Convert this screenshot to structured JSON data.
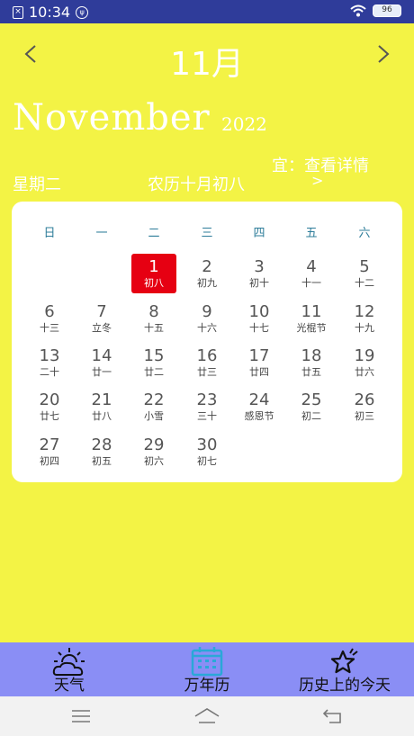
{
  "status_bar": {
    "time": "10:34",
    "battery": "96"
  },
  "header": {
    "month_title": "11月",
    "english_month": "November",
    "year": "2022",
    "yi_text": "宜：查看详情",
    "detail_arrow": ">",
    "weekday": "星期二",
    "lunar_date": "农历十月初八"
  },
  "calendar": {
    "weekday_headers": [
      "日",
      "一",
      "二",
      "三",
      "四",
      "五",
      "六"
    ],
    "weeks": [
      [
        null,
        null,
        {
          "day": "1",
          "sub": "初八",
          "selected": true
        },
        {
          "day": "2",
          "sub": "初九"
        },
        {
          "day": "3",
          "sub": "初十"
        },
        {
          "day": "4",
          "sub": "十一"
        },
        {
          "day": "5",
          "sub": "十二"
        }
      ],
      [
        {
          "day": "6",
          "sub": "十三"
        },
        {
          "day": "7",
          "sub": "立冬"
        },
        {
          "day": "8",
          "sub": "十五"
        },
        {
          "day": "9",
          "sub": "十六"
        },
        {
          "day": "10",
          "sub": "十七"
        },
        {
          "day": "11",
          "sub": "光棍节"
        },
        {
          "day": "12",
          "sub": "十九"
        }
      ],
      [
        {
          "day": "13",
          "sub": "二十"
        },
        {
          "day": "14",
          "sub": "廿一"
        },
        {
          "day": "15",
          "sub": "廿二"
        },
        {
          "day": "16",
          "sub": "廿三"
        },
        {
          "day": "17",
          "sub": "廿四"
        },
        {
          "day": "18",
          "sub": "廿五"
        },
        {
          "day": "19",
          "sub": "廿六"
        }
      ],
      [
        {
          "day": "20",
          "sub": "廿七"
        },
        {
          "day": "21",
          "sub": "廿八"
        },
        {
          "day": "22",
          "sub": "小雪"
        },
        {
          "day": "23",
          "sub": "三十"
        },
        {
          "day": "24",
          "sub": "感恩节"
        },
        {
          "day": "25",
          "sub": "初二"
        },
        {
          "day": "26",
          "sub": "初三"
        }
      ],
      [
        {
          "day": "27",
          "sub": "初四"
        },
        {
          "day": "28",
          "sub": "初五"
        },
        {
          "day": "29",
          "sub": "初六"
        },
        {
          "day": "30",
          "sub": "初七"
        },
        null,
        null,
        null
      ]
    ]
  },
  "tabs": [
    {
      "label": "天气",
      "icon": "weather-icon"
    },
    {
      "label": "万年历",
      "icon": "calendar-icon",
      "active": true
    },
    {
      "label": "历史上的今天",
      "icon": "star-icon"
    }
  ],
  "colors": {
    "background": "#f3f345",
    "status_bar": "#2f3c9a",
    "selected_day": "#e60012",
    "tab_bar": "#8a8ef5",
    "active_tab_icon": "#2aa8d8",
    "weekday_header": "#2e7d9a"
  }
}
